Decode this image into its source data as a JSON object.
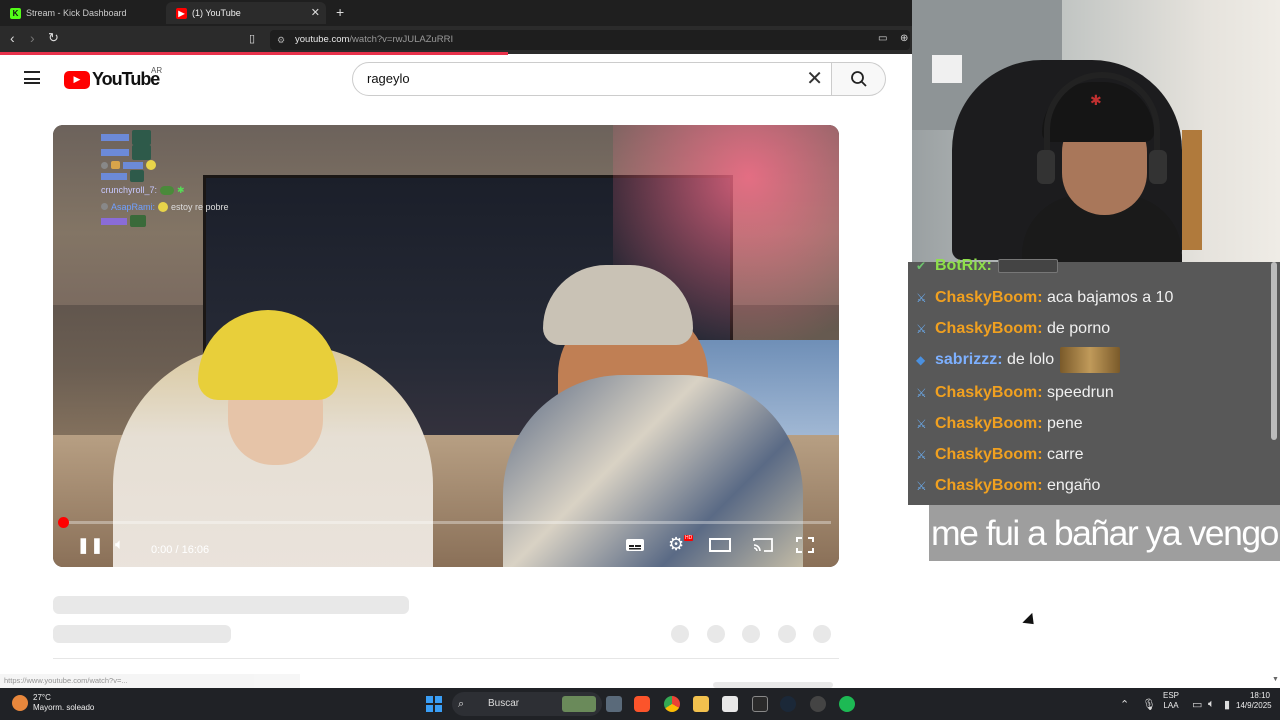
{
  "browser": {
    "tabs": [
      {
        "title": "Stream - Kick Dashboard",
        "active": false
      },
      {
        "title": "(1) YouTube",
        "active": true
      }
    ],
    "url_domain": "youtube.com",
    "url_path": "/watch?v=rwJULAZuRRI"
  },
  "youtube": {
    "logo_text": "YouTube",
    "country": "AR",
    "search_value": "rageylo"
  },
  "player": {
    "time": "0:00 / 16:06",
    "progress_fraction": 0.0,
    "chat_overlay": [
      {
        "user": "",
        "message": ""
      },
      {
        "user": "",
        "message": ""
      },
      {
        "user": "",
        "message": ""
      },
      {
        "user": "",
        "message": ""
      },
      {
        "user": "crunchyroll_7:",
        "message": ""
      },
      {
        "user": "AsapRami:",
        "message": "estoy re pobre"
      },
      {
        "user": "",
        "message": ""
      }
    ]
  },
  "status_link": "https://www.youtube.com/watch?v=...",
  "kick_chat": {
    "messages": [
      {
        "user": "BotRix:",
        "text": "",
        "color": "green",
        "emote": true
      },
      {
        "user": "ChaskyBoom:",
        "text": "aca bajamos a 10",
        "color": "orange"
      },
      {
        "user": "ChaskyBoom:",
        "text": "de porno",
        "color": "orange"
      },
      {
        "user": "sabrizzz:",
        "text": "de lolo",
        "color": "blue",
        "emote": true
      },
      {
        "user": "ChaskyBoom:",
        "text": "speedrun",
        "color": "orange"
      },
      {
        "user": "ChaskyBoom:",
        "text": "pene",
        "color": "orange"
      },
      {
        "user": "ChaskyBoom:",
        "text": "carre",
        "color": "orange"
      },
      {
        "user": "ChaskyBoom:",
        "text": "engaño",
        "color": "orange"
      }
    ]
  },
  "overlay_caption": "me fui a bañar ya vengo",
  "taskbar": {
    "temperature": "27°C",
    "weather": "Mayorm. soleado",
    "search_label": "Buscar",
    "lang_top": "ESP",
    "lang_bottom": "LAA",
    "clock_time": "18:10",
    "clock_date": "14/9/2025"
  }
}
